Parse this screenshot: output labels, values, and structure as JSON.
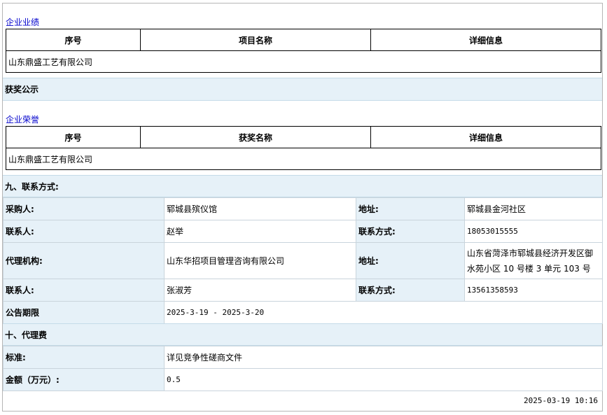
{
  "performance": {
    "title": "企业业绩",
    "headers": [
      "序号",
      "项目名称",
      "详细信息"
    ],
    "row": "山东鼎盛工艺有限公司"
  },
  "awards_band": "获奖公示",
  "honors": {
    "title": "企业荣誉",
    "headers": [
      "序号",
      "获奖名称",
      "详细信息"
    ],
    "row": "山东鼎盛工艺有限公司"
  },
  "contact": {
    "title": "九、联系方式:",
    "purchaser_label": "采购人:",
    "purchaser": "郓城县殡仪馆",
    "address_label": "地址:",
    "purchaser_address": "郓城县金河社区",
    "contact_label": "联系人:",
    "purchaser_contact": "赵举",
    "phone_label": "联系方式:",
    "purchaser_phone": "18053015555",
    "agency_label": "代理机构:",
    "agency": "山东华招项目管理咨询有限公司",
    "agency_address": "山东省菏泽市郓城县经济开发区御水苑小区 10 号楼 3 单元 103 号",
    "agency_contact": "张淑芳",
    "agency_phone": "13561358593",
    "period_label": "公告期限",
    "period": "2025-3-19 - 2025-3-20"
  },
  "fee": {
    "title": "十、代理费",
    "standard_label": "标准:",
    "standard": "详见竞争性磋商文件",
    "amount_label": "金额（万元）:",
    "amount": "0.5"
  },
  "timestamp": "2025-03-19 10:16"
}
